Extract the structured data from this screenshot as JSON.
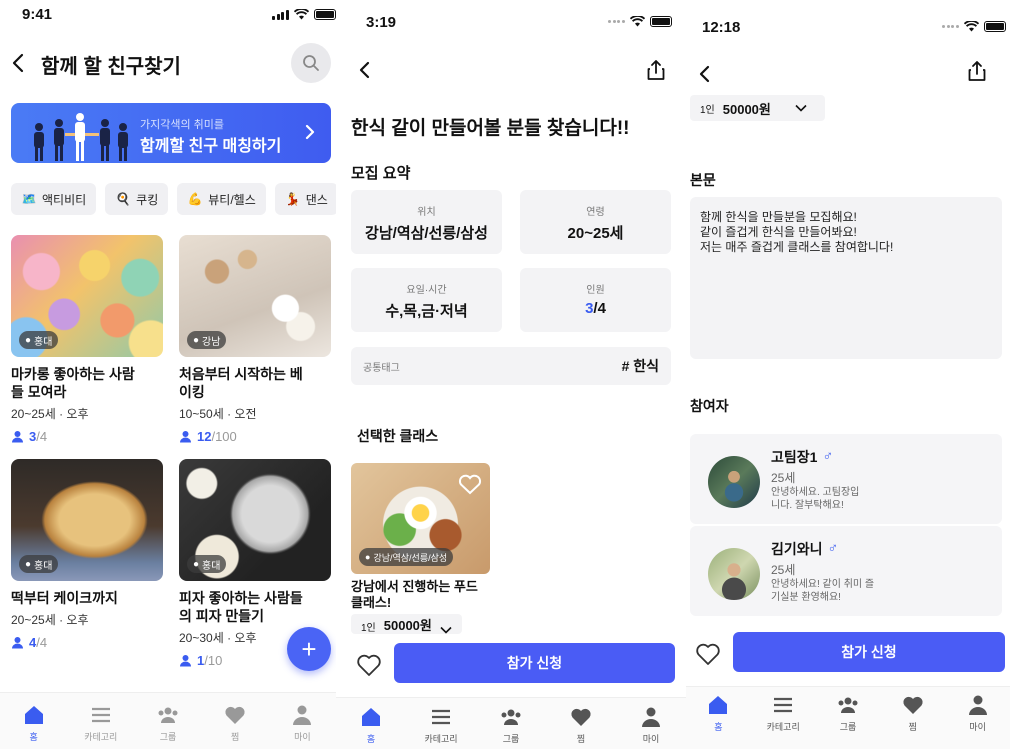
{
  "screen1": {
    "status_time": "9:41",
    "title": "함께 할 친구찾기",
    "banner": {
      "subtitle": "가지각색의 취미를",
      "title": "함께할 친구 매칭하기"
    },
    "categories": [
      {
        "label": "액티비티",
        "icon": "activity-icon"
      },
      {
        "label": "쿠킹",
        "icon": "cooking-icon"
      },
      {
        "label": "뷰티/헬스",
        "icon": "muscle-icon"
      },
      {
        "label": "댄스",
        "icon": "dance-icon"
      }
    ],
    "cards": [
      {
        "location": "홍대",
        "title_line1": "마카롱 좋아하는 사람",
        "title_line2": "들 모여라",
        "meta": "20~25세 · 오후",
        "current": "3",
        "max": "/4"
      },
      {
        "location": "강남",
        "title_line1": "처음부터 시작하는 베",
        "title_line2": "이킹",
        "meta": "10~50세 · 오전",
        "current": "12",
        "max": "/100"
      },
      {
        "location": "홍대",
        "title_line1": "떡부터 케이크까지",
        "title_line2": "",
        "meta": "20~25세 · 오후",
        "current": "4",
        "max": "/4"
      },
      {
        "location": "홍대",
        "title_line1": "피자 좋아하는 사람들",
        "title_line2": "의 피자 만들기",
        "meta": "20~30세 · 오후",
        "current": "1",
        "max": "/10"
      }
    ],
    "fab_label": "+"
  },
  "screen2": {
    "status_time": "3:19",
    "post_title": "한식 같이 만들어볼 분들 찾습니다!!",
    "summary_label": "모집 요약",
    "info": {
      "location_label": "위치",
      "location_value": "강남/역삼/선릉/삼성",
      "age_label": "연령",
      "age_value": "20~25세",
      "time_label": "요일·시간",
      "time_value": "수,목,금·저녁",
      "people_label": "인원",
      "people_current": "3",
      "people_max": "/4"
    },
    "tag_label": "공통태그",
    "tag_value": "# 한식",
    "class_label": "선택한 클래스",
    "class": {
      "location": "강남/역삼/선릉/삼성",
      "title_line1": "강남에서 진행하는 푸드",
      "title_line2": "클래스!",
      "unit": "1인",
      "price": "50000원"
    },
    "apply_label": "참가 신청"
  },
  "screen3": {
    "status_time": "12:18",
    "price_unit": "1인",
    "price": "50000원",
    "body_label": "본문",
    "body_lines": [
      "함께 한식을 만들분을 모집해요!",
      "같이 즐겁게 한식을 만들어봐요!",
      "저는 매주 즐겁게 클래스를 참여합니다!"
    ],
    "members_label": "참여자",
    "members": [
      {
        "name": "고팀장1",
        "gender": "♂",
        "age": "25세",
        "intro_line1": "안녕하세요. 고팀장입",
        "intro_line2": "니다. 잘부탁해요!"
      },
      {
        "name": "김기와니",
        "gender": "♂",
        "age": "25세",
        "intro_line1": "안녕하세요! 같이 취미 즐",
        "intro_line2": "기실분 환영해요!"
      }
    ],
    "apply_label": "참가 신청"
  },
  "tabbar": [
    {
      "label": "홈",
      "icon": "home-icon"
    },
    {
      "label": "카테고리",
      "icon": "menu-icon"
    },
    {
      "label": "그룹",
      "icon": "group-icon"
    },
    {
      "label": "찜",
      "icon": "heart-icon"
    },
    {
      "label": "마이",
      "icon": "person-icon"
    }
  ],
  "colors": {
    "accent": "#4a5cf5",
    "count_highlight": "#3a5cf0",
    "box_bg": "#f3f3f5"
  }
}
